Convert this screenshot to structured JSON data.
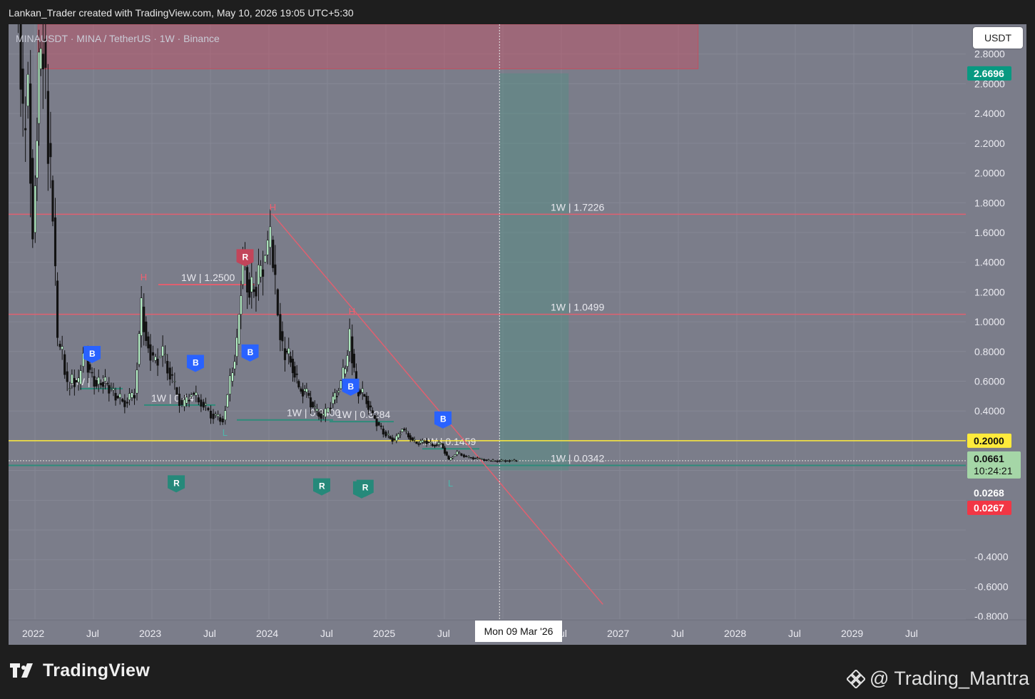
{
  "caption": "Lankan_Trader created with TradingView.com, May 10, 2026 19:05 UTC+5:30",
  "symbol_title": "MINAUSDT · MINA / TetherUS · 1W · Binance",
  "currency": "USDT",
  "crosshair_date": "Mon 09 Mar '26",
  "brand": "TradingView",
  "watermark": "@ Trading_Mantra",
  "chart_data": {
    "type": "candlestick",
    "x_axis_labels": [
      "2022",
      "Jul",
      "2023",
      "Jul",
      "2024",
      "Jul",
      "2025",
      "Jul",
      "2026",
      "Jul",
      "2027",
      "Jul",
      "2028",
      "Jul",
      "2029",
      "Jul"
    ],
    "y_axis_labels": [
      "2.8000",
      "2.6000",
      "2.4000",
      "2.2000",
      "2.0000",
      "1.8000",
      "1.6000",
      "1.4000",
      "1.2000",
      "1.0000",
      "0.8000",
      "0.6000",
      "0.4000",
      "0.2000",
      "0.0000",
      "-0.4000",
      "-0.6000",
      "-0.8000"
    ],
    "ylim": [
      -0.98,
      3.0
    ],
    "price_tags": [
      {
        "label": "2.6696",
        "value": 2.6696,
        "bg": "#089981",
        "fg": "#ffffff"
      },
      {
        "label": "0.2000",
        "value": 0.2,
        "bg": "#ffeb3b",
        "fg": "#111111"
      },
      {
        "label": "0.0661",
        "value": 0.0661,
        "sub": "10:24:21",
        "bg": "#a5d6a7",
        "fg": "#111111"
      },
      {
        "label": "0.0268",
        "value": -0.1,
        "bg": "#7b7d8a",
        "fg": "#ffffff"
      },
      {
        "label": "0.0267",
        "value": -0.2,
        "bg": "#f23645",
        "fg": "#ffffff"
      }
    ],
    "levels": [
      {
        "label": "1W | 1.7226",
        "value": 1.7226,
        "color": "#e06070"
      },
      {
        "label": "1W | 1.0499",
        "value": 1.0499,
        "color": "#e06070"
      },
      {
        "label": "1W | 1.2500",
        "value": 1.25,
        "color": "#e06070"
      },
      {
        "label": "1W | 0.5",
        "value": 0.55,
        "color": "#2e8b7a"
      },
      {
        "label": "1W | 0.44",
        "value": 0.44,
        "color": "#2e8b7a"
      },
      {
        "label": "1W | 0.3400",
        "value": 0.34,
        "color": "#2e8b7a"
      },
      {
        "label": "1W | 0.3284",
        "value": 0.3284,
        "color": "#2e8b7a"
      },
      {
        "label": "1W | 0.1459",
        "value": 0.1459,
        "color": "#2e8b7a"
      },
      {
        "label": "1W | 0.0342",
        "value": 0.0342,
        "color": "#2e8b7a"
      }
    ],
    "markers": [
      {
        "type": "B",
        "x": "2022-08-20",
        "y": 0.78
      },
      {
        "type": "B",
        "x": "2023-07-15",
        "y": 0.72
      },
      {
        "type": "B",
        "x": "2024-01-05",
        "y": 0.79
      },
      {
        "type": "B",
        "x": "2024-11-20",
        "y": 0.56
      },
      {
        "type": "B",
        "x": "2025-09-10",
        "y": 0.34
      },
      {
        "type": "R",
        "x": "2023-12-20",
        "y": 1.43
      },
      {
        "type": "R",
        "x": "2023-05-15",
        "y": -0.09
      },
      {
        "type": "R",
        "x": "2024-08-20",
        "y": -0.11
      },
      {
        "type": "R",
        "x": "2024-12-25",
        "y": -0.13
      },
      {
        "type": "R",
        "x": "2025-01-05",
        "y": -0.12
      }
    ],
    "labels_h": [
      {
        "text": "H",
        "x": "2023-02-01",
        "y": 1.25
      },
      {
        "text": "H",
        "x": "2024-03-18",
        "y": 1.72
      },
      {
        "text": "H",
        "x": "2024-11-25",
        "y": 1.02
      }
    ],
    "labels_l": [
      {
        "text": "L",
        "x": "2023-10-18",
        "y": 0.3
      },
      {
        "text": "L",
        "x": "2025-10-05",
        "y": -0.04
      }
    ],
    "zones": [
      {
        "name": "resistance",
        "x1": "2022-03-01",
        "x2": "2027-12-01",
        "y1": 2.7,
        "y2": 3.0,
        "color": "rgba(200,80,100,0.45)"
      },
      {
        "name": "target",
        "x1": "2026-03-09",
        "x2": "2026-10-15",
        "y1": 0.0,
        "y2": 2.6696,
        "color": "rgba(70,150,130,0.35)"
      }
    ],
    "trendline": {
      "from": {
        "x": "2024-03-18",
        "y": 1.72
      },
      "to": {
        "x": "2027-02-01",
        "y": -0.9
      },
      "color": "#e06070"
    },
    "highlight_lines": [
      {
        "value": 0.2,
        "color": "#ffeb3b"
      },
      {
        "value": 0.0661,
        "color": "#c0c0c0",
        "dotted": true
      }
    ],
    "price_path": [
      [
        "2021-12-20",
        3.4
      ],
      [
        "2022-01-05",
        3.1
      ],
      [
        "2022-01-20",
        2.3
      ],
      [
        "2022-02-05",
        2.6
      ],
      [
        "2022-02-20",
        1.6
      ],
      [
        "2022-03-10",
        2.7
      ],
      [
        "2022-03-25",
        2.9
      ],
      [
        "2022-04-10",
        2.2
      ],
      [
        "2022-04-25",
        1.7
      ],
      [
        "2022-05-10",
        0.85
      ],
      [
        "2022-05-25",
        0.78
      ],
      [
        "2022-06-10",
        0.55
      ],
      [
        "2022-06-25",
        0.62
      ],
      [
        "2022-07-15",
        0.58
      ],
      [
        "2022-08-01",
        0.82
      ],
      [
        "2022-08-20",
        0.66
      ],
      [
        "2022-09-10",
        0.58
      ],
      [
        "2022-10-01",
        0.6
      ],
      [
        "2022-10-20",
        0.56
      ],
      [
        "2022-11-10",
        0.5
      ],
      [
        "2022-12-10",
        0.46
      ],
      [
        "2023-01-10",
        0.52
      ],
      [
        "2023-02-01",
        1.1
      ],
      [
        "2023-02-15",
        0.9
      ],
      [
        "2023-03-10",
        0.74
      ],
      [
        "2023-04-10",
        0.78
      ],
      [
        "2023-05-10",
        0.6
      ],
      [
        "2023-06-10",
        0.43
      ],
      [
        "2023-07-10",
        0.52
      ],
      [
        "2023-08-10",
        0.46
      ],
      [
        "2023-09-10",
        0.38
      ],
      [
        "2023-10-18",
        0.34
      ],
      [
        "2023-11-10",
        0.6
      ],
      [
        "2023-12-01",
        0.85
      ],
      [
        "2023-12-20",
        1.45
      ],
      [
        "2024-01-10",
        1.2
      ],
      [
        "2024-02-01",
        1.25
      ],
      [
        "2024-03-01",
        1.45
      ],
      [
        "2024-03-18",
        1.55
      ],
      [
        "2024-04-10",
        1.05
      ],
      [
        "2024-04-25",
        0.82
      ],
      [
        "2024-05-20",
        0.75
      ],
      [
        "2024-06-15",
        0.55
      ],
      [
        "2024-07-10",
        0.52
      ],
      [
        "2024-08-05",
        0.4
      ],
      [
        "2024-09-01",
        0.36
      ],
      [
        "2024-09-25",
        0.45
      ],
      [
        "2024-10-20",
        0.55
      ],
      [
        "2024-11-10",
        0.7
      ],
      [
        "2024-11-25",
        0.9
      ],
      [
        "2024-12-15",
        0.55
      ],
      [
        "2025-01-10",
        0.5
      ],
      [
        "2025-02-05",
        0.37
      ],
      [
        "2025-02-25",
        0.3
      ],
      [
        "2025-03-20",
        0.24
      ],
      [
        "2025-04-15",
        0.2
      ],
      [
        "2025-05-10",
        0.28
      ],
      [
        "2025-06-05",
        0.22
      ],
      [
        "2025-06-25",
        0.18
      ],
      [
        "2025-07-20",
        0.2
      ],
      [
        "2025-08-15",
        0.17
      ],
      [
        "2025-09-10",
        0.18
      ],
      [
        "2025-10-05",
        0.07
      ],
      [
        "2025-11-01",
        0.12
      ],
      [
        "2025-12-01",
        0.09
      ],
      [
        "2026-01-05",
        0.08
      ],
      [
        "2026-02-10",
        0.066
      ],
      [
        "2026-03-09",
        0.065
      ],
      [
        "2026-04-10",
        0.067
      ],
      [
        "2026-05-10",
        0.0661
      ]
    ]
  }
}
